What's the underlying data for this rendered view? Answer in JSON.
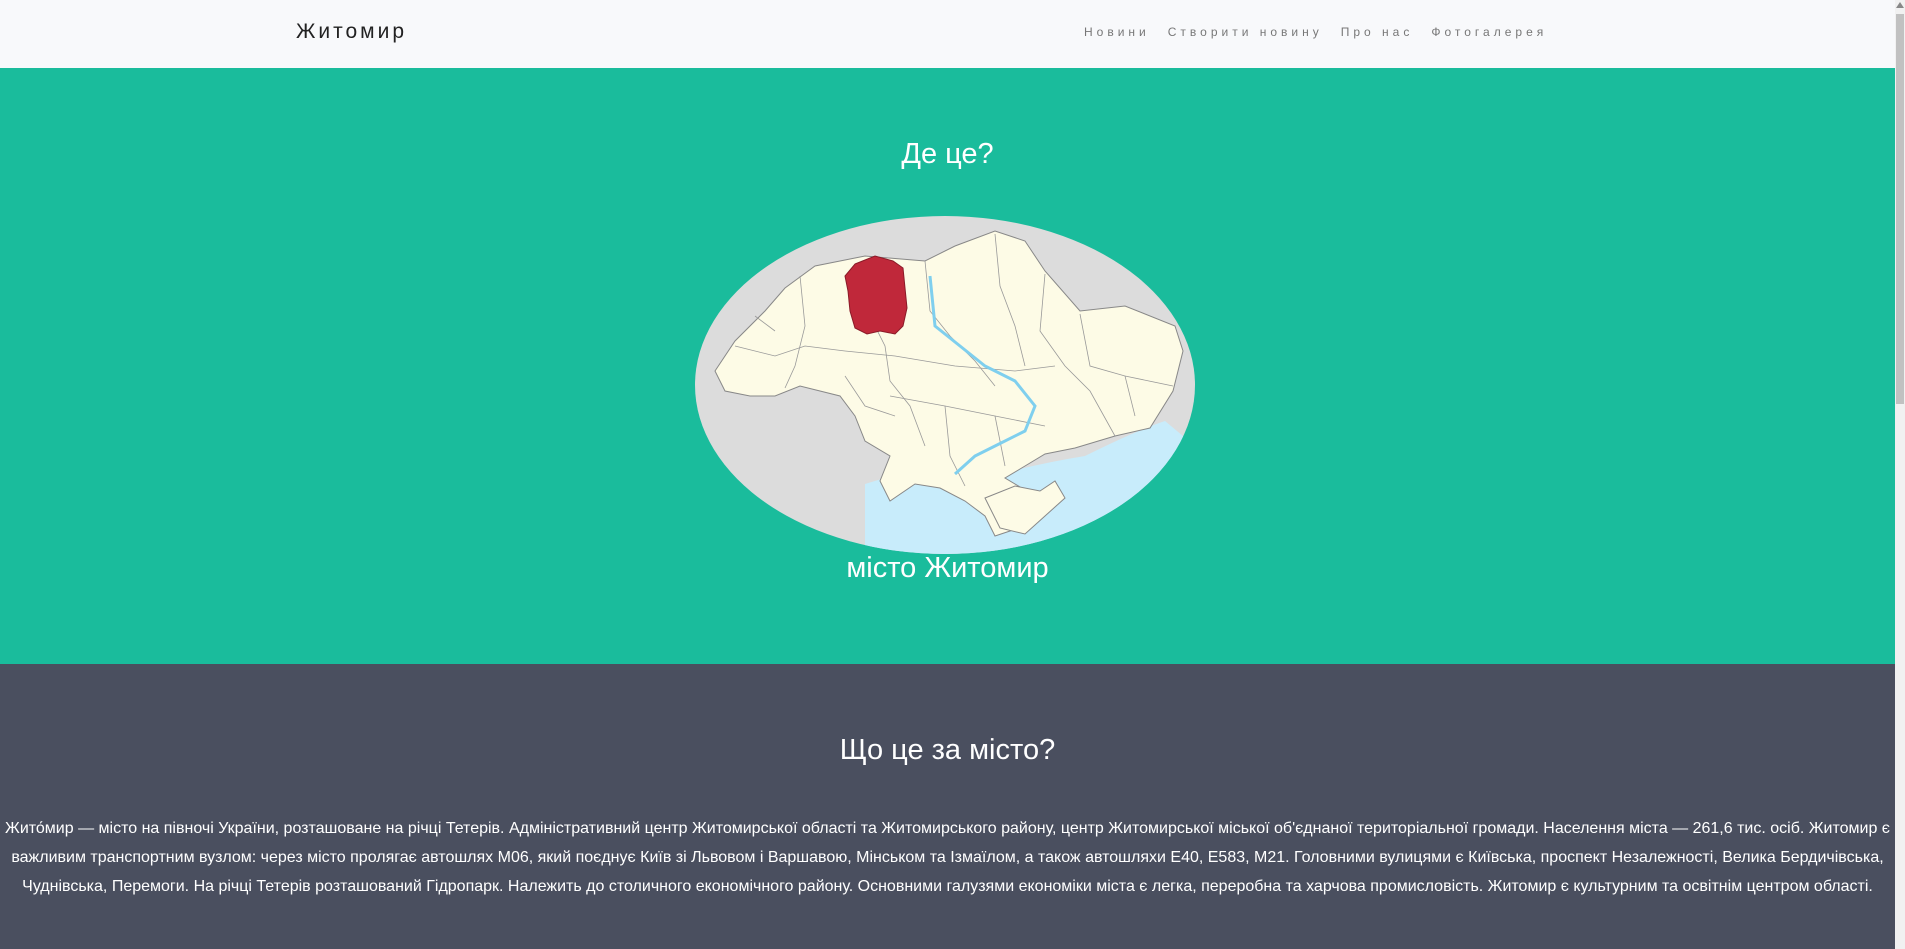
{
  "navbar": {
    "brand": "Житомир",
    "links": [
      {
        "label": "Новини"
      },
      {
        "label": "Створити новину"
      },
      {
        "label": "Про нас"
      },
      {
        "label": "Фотогалерея"
      }
    ]
  },
  "hero": {
    "title": "Де це?",
    "caption": "місто Житомир",
    "colors": {
      "background": "#1abc9c",
      "highlight_region": "#c0283a",
      "land": "#fdfbe6",
      "water": "#c8ecfb",
      "outside": "#dcdcdc"
    }
  },
  "about": {
    "title": "Що це за місто?",
    "text": "Жито́мир — місто на півночі України, розташоване на річці Тетерів. Адміністративний центр Житомирської області та Житомирського району, центр Житомирської міської об'єднаної територіальної громади. Населення міста — 261,6 тис. осіб. Житомир є важливим транспортним вузлом: через місто пролягає автошлях М06, який поєднує Київ зі Львовом і Варшавою, Мінськом та Ізмаїлом, а також автошляхи Е40, Е583, М21. Головними вулицями є Київська, проспект Незалежності, Велика Бердичівська, Чуднівська, Перемоги. На річці Тетерів розташований Гідропарк. Належить до столичного економічного району. Основними галузями економіки міста є легка, переробна та харчова промисловість. Житомир є культурним та освітнім центром області.",
    "background": "#4a4f5f"
  }
}
